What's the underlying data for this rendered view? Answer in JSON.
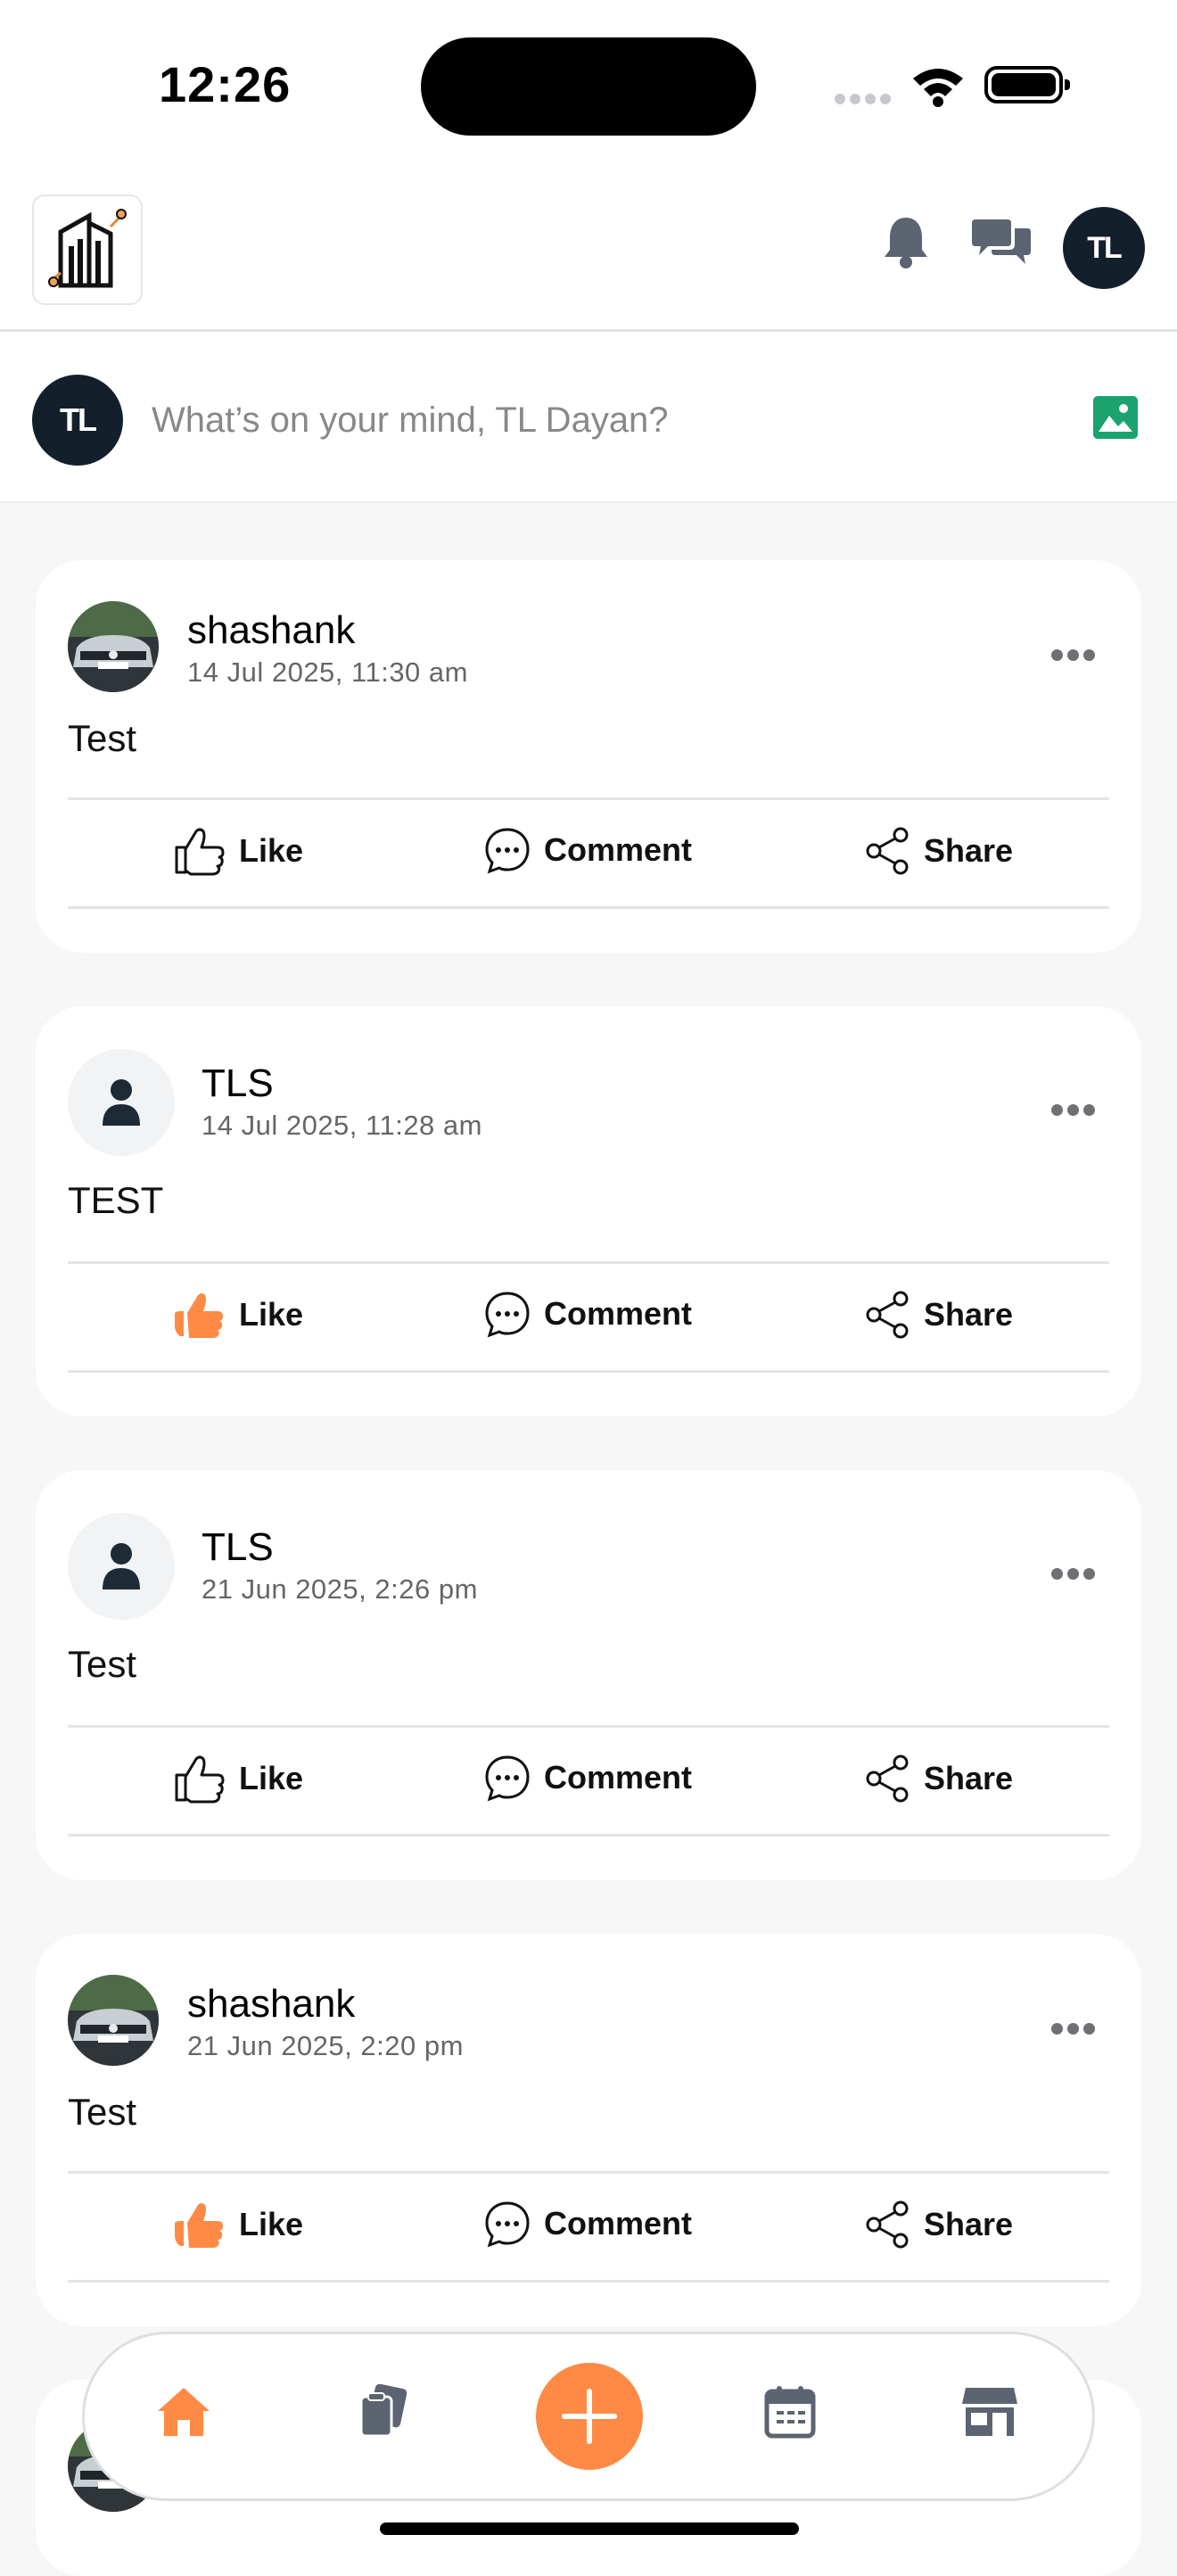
{
  "status_bar": {
    "time": "12:26"
  },
  "header": {
    "logo_icon": "building-logo-icon",
    "notifications_icon": "bell-icon",
    "messages_icon": "chat-bubbles-icon",
    "profile_initials": "TL"
  },
  "composer": {
    "avatar_initials": "TL",
    "placeholder": "What’s on your mind, TL Dayan?",
    "image_icon": "image-icon"
  },
  "actions": {
    "like": "Like",
    "comment": "Comment",
    "share": "Share"
  },
  "posts": [
    {
      "author": "shashank",
      "timestamp": "14 Jul 2025, 11:30 am",
      "text": "Test",
      "avatar": "car-photo",
      "liked": false
    },
    {
      "author": "TLS",
      "timestamp": "14 Jul 2025, 11:28 am",
      "text": "TEST",
      "avatar": "default-user",
      "liked": true
    },
    {
      "author": "TLS",
      "timestamp": "21 Jun 2025, 2:26 pm",
      "text": "Test",
      "avatar": "default-user",
      "liked": false
    },
    {
      "author": "shashank",
      "timestamp": "21 Jun 2025, 2:20 pm",
      "text": "Test",
      "avatar": "car-photo",
      "liked": true
    }
  ],
  "bottom_nav": {
    "items": [
      "home-icon",
      "documents-icon",
      "add-icon",
      "calendar-icon",
      "store-icon"
    ],
    "active": "home-icon"
  },
  "colors": {
    "accent": "#ff8a45",
    "dark": "#13202b",
    "image_green": "#1aa36f"
  }
}
